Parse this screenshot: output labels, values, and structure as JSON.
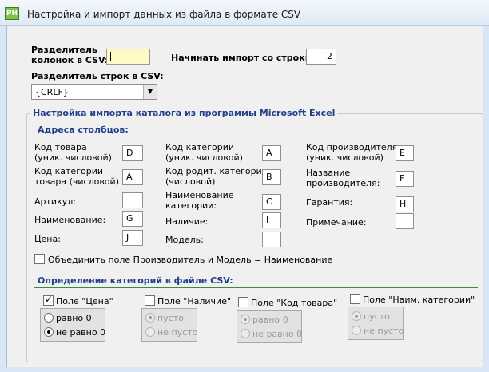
{
  "window": {
    "title": "Настройка и импорт данных из файла в формате CSV",
    "icon": "app-icon"
  },
  "top": {
    "col_sep_label_1": "Разделитель",
    "col_sep_label_2": "колонок в CSV:",
    "col_sep_value": "",
    "start_row_label": "Начинать импорт со строки:",
    "start_row_value": "2",
    "row_sep_label": "Разделитель строк в CSV:",
    "row_sep_value": "{CRLF}"
  },
  "excel_group": {
    "title": "Настройка импорта каталога из программы Microsoft Excel",
    "columns_section": "Адреса столбцов:",
    "fields": [
      {
        "label1": "Код товара",
        "label2": "(уник. числовой)",
        "value": "D"
      },
      {
        "label1": "Код категории",
        "label2": "товара (числовой)",
        "value": "A"
      },
      {
        "label1": "Артикул:",
        "label2": "",
        "value": ""
      },
      {
        "label1": "Наименование:",
        "label2": "",
        "value": "G"
      },
      {
        "label1": "Цена:",
        "label2": "",
        "value": "J"
      },
      {
        "label1": "Код категории",
        "label2": "(уник. числовой)",
        "value": "A"
      },
      {
        "label1": "Код родит. категории",
        "label2": "(числовой)",
        "value": "B"
      },
      {
        "label1": "Наименование",
        "label2": "категории:",
        "value": "C"
      },
      {
        "label1": "Наличие:",
        "label2": "",
        "value": "I"
      },
      {
        "label1": "Модель:",
        "label2": "",
        "value": ""
      },
      {
        "label1": "Код производителя",
        "label2": "(уник. числовой)",
        "value": "E"
      },
      {
        "label1": "Название",
        "label2": "производителя:",
        "value": "F"
      },
      {
        "label1": "Гарантия:",
        "label2": "",
        "value": "H"
      },
      {
        "label1": "Примечание:",
        "label2": "",
        "value": ""
      }
    ],
    "merge_checkbox_label": "Объединить поле Производитель и Модель = Наименование",
    "merge_checked": false,
    "categories_section": "Определение категорий в файле CSV:",
    "category_rules": [
      {
        "label": "Поле \"Цена\"",
        "checked": true,
        "opt1": "равно 0",
        "opt2": "не равно 0",
        "selected": 1,
        "enabled": true
      },
      {
        "label": "Поле \"Наличие\"",
        "checked": false,
        "opt1": "пусто",
        "opt2": "не пусто",
        "selected": 1,
        "enabled": false
      },
      {
        "label": "Поле \"Код товара\"",
        "checked": false,
        "opt1": "равно 0",
        "opt2": "не равно 0",
        "selected": 1,
        "enabled": false
      },
      {
        "label": "Поле \"Наим. категории\"",
        "checked": false,
        "opt1": "пусто",
        "opt2": "не пусто",
        "selected": 1,
        "enabled": false
      }
    ]
  },
  "colors": {
    "title_section": "#1f3f8a",
    "rule": "#3c8a3c",
    "highlight_input": "#fff9c4"
  }
}
